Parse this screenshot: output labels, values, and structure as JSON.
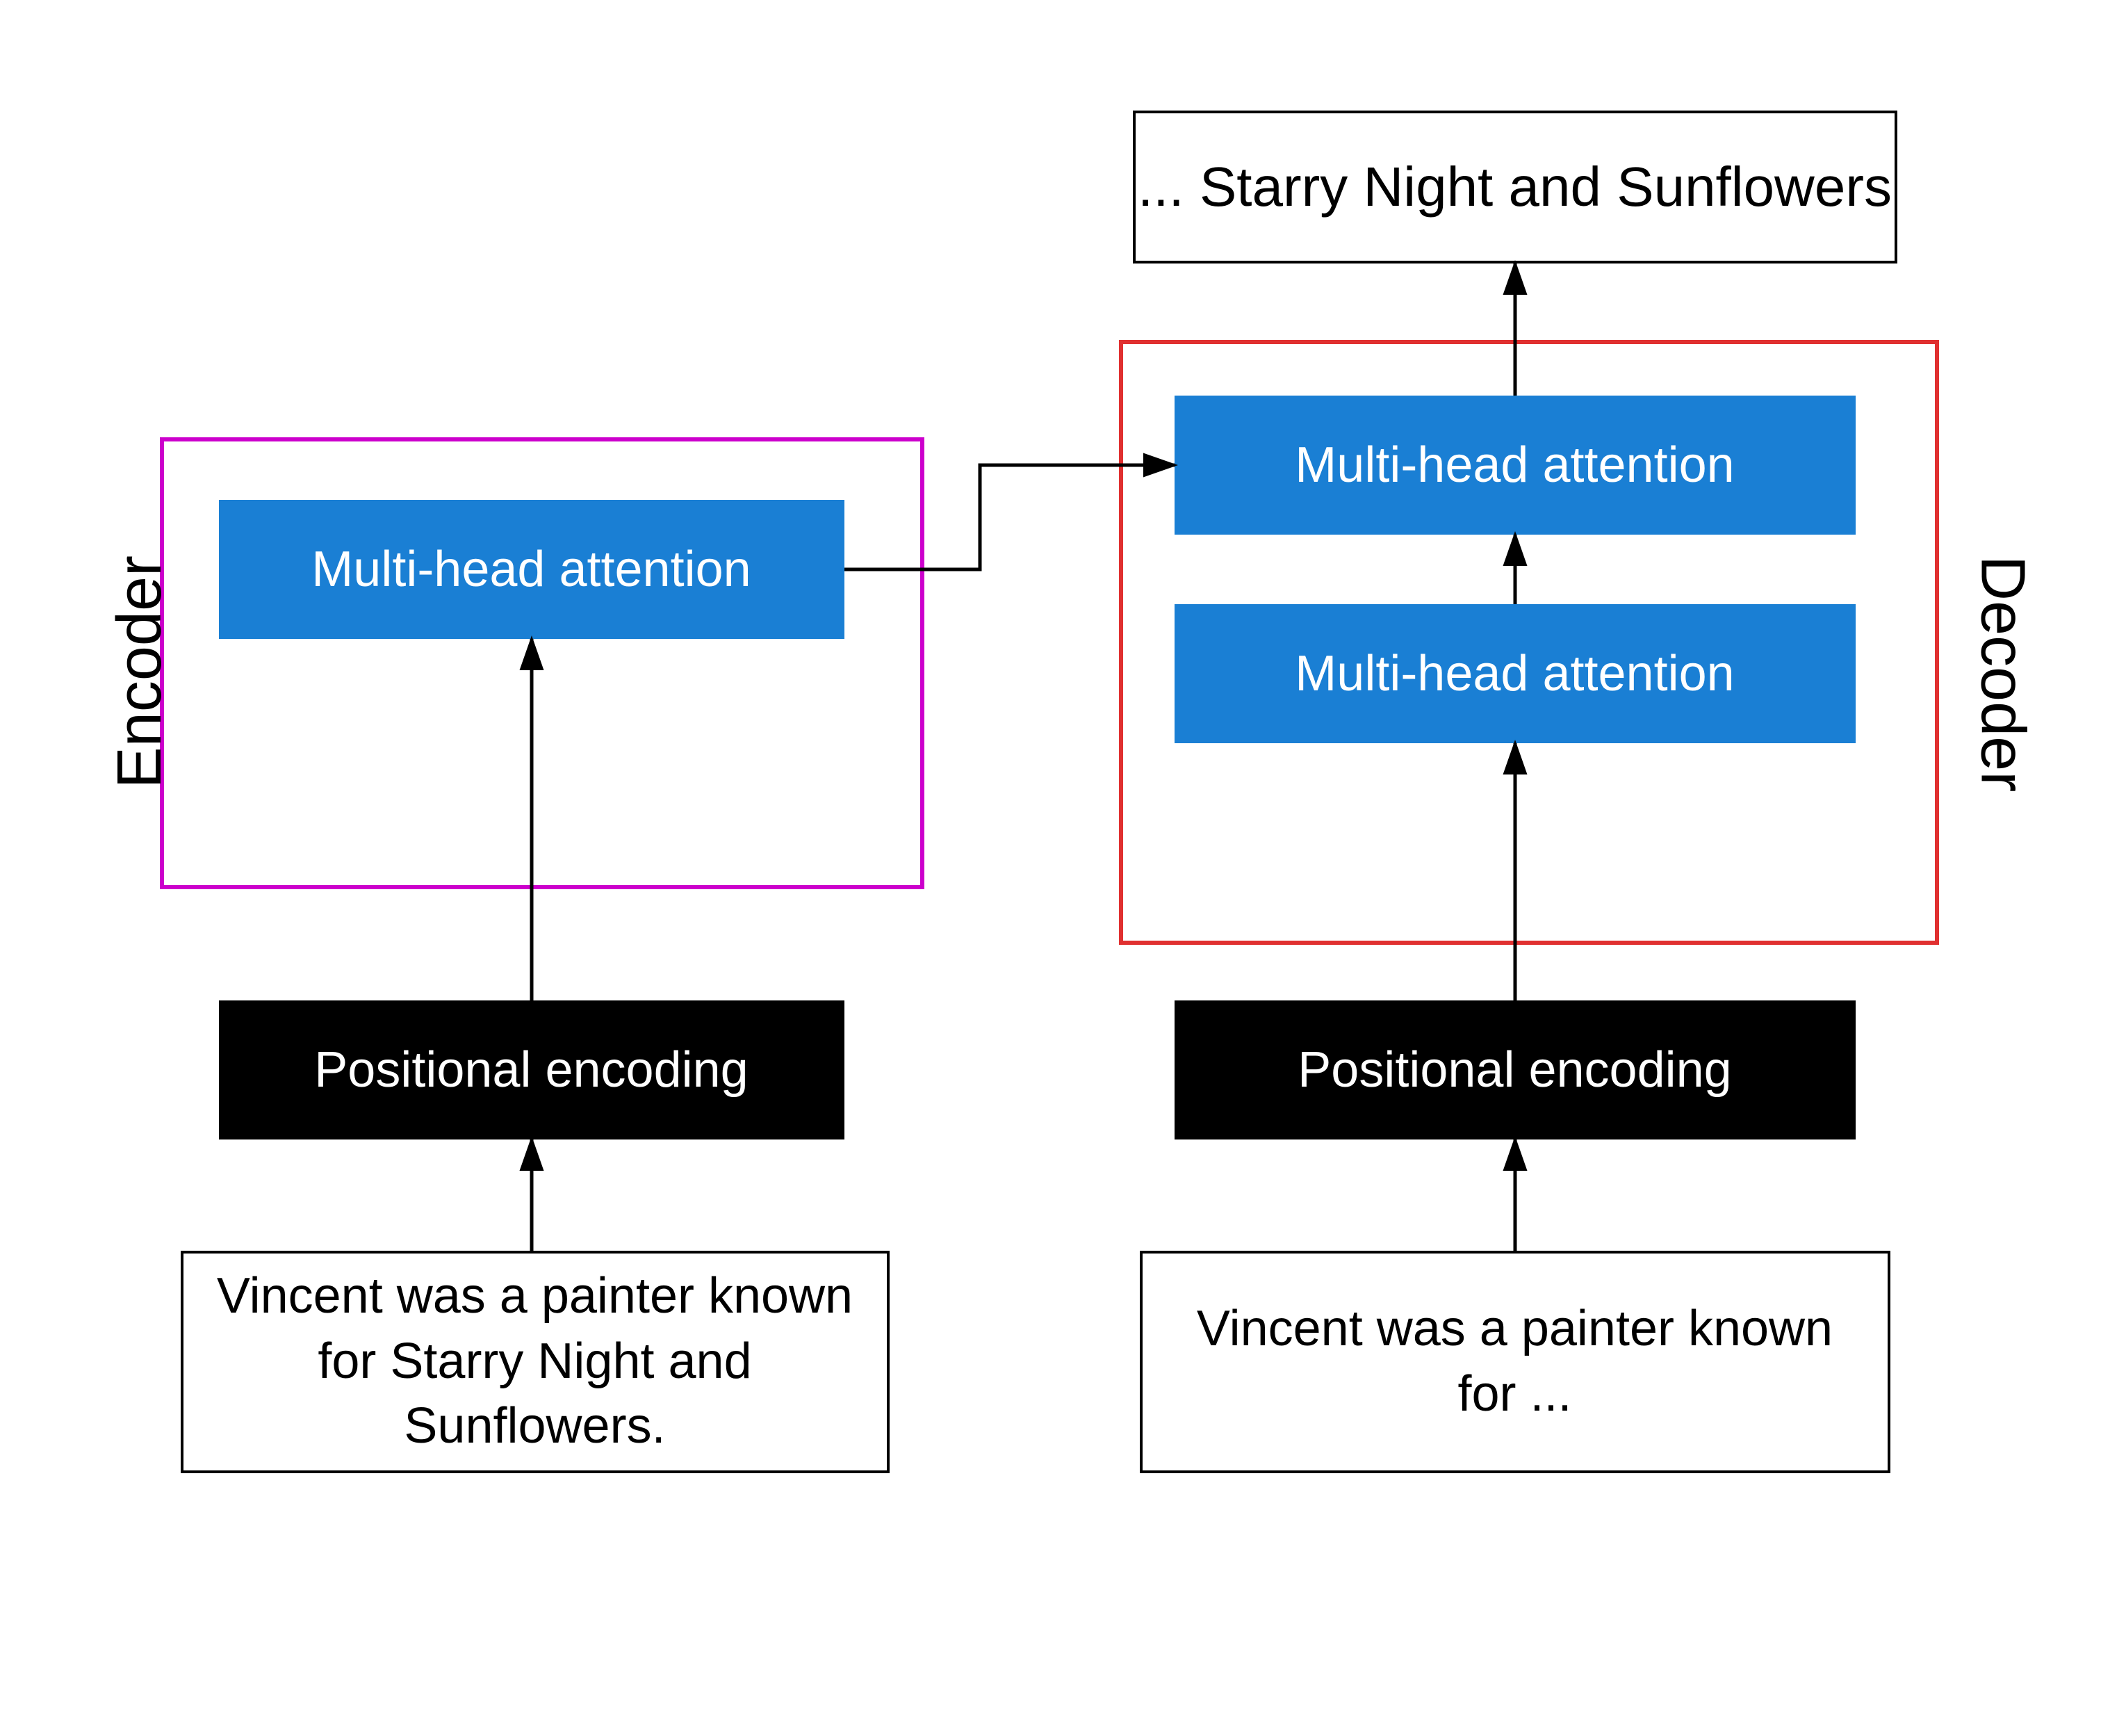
{
  "output": {
    "text": "... Starry Night and Sunflowers"
  },
  "encoder": {
    "label": "Encoder",
    "mha_label": "Multi-head attention",
    "pos_label": "Positional encoding",
    "input_text": "Vincent was a painter known for Starry Night and Sunflowers."
  },
  "decoder": {
    "label": "Decoder",
    "mha_top_label": "Multi-head attention",
    "mha_bot_label": "Multi-head attention",
    "pos_label": "Positional encoding",
    "input_text": "Vincent was a painter known for ..."
  }
}
